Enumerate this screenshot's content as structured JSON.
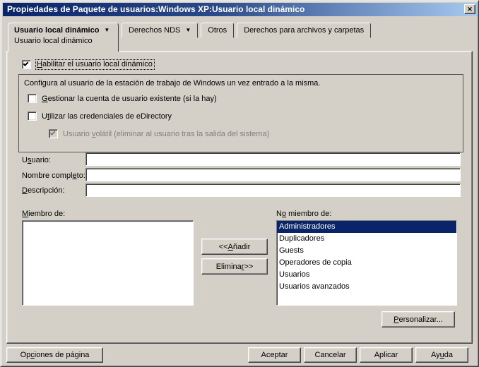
{
  "window": {
    "title": "Propiedades de Paquete de usuarios:Windows XP:Usuario local dinámico"
  },
  "icons": {
    "close": "✕",
    "dropdown": "▼"
  },
  "colors": {
    "dialog_bg": "#D4D0C8",
    "titlebar_gradient_start": "#0A246A",
    "titlebar_gradient_end": "#A6CAF0",
    "selection_bg": "#0A246A",
    "selection_text": "#FFFFFF",
    "disabled_text": "#808080"
  },
  "tabs": {
    "active": {
      "label": "Usuario local dinámico",
      "sub_label": "Usuario local dinámico",
      "has_dropdown": true
    },
    "items": [
      {
        "label": "Derechos NDS",
        "has_dropdown": true
      },
      {
        "label": "Otros",
        "has_dropdown": false
      },
      {
        "label": "Derechos para archivos y carpetas",
        "has_dropdown": false
      }
    ]
  },
  "checkboxes": {
    "enable": {
      "pre": "",
      "key": "H",
      "post": "abilitar el usuario local dinámico",
      "checked": true,
      "focused": true
    },
    "manage": {
      "pre": "",
      "key": "G",
      "post": "estionar la cuenta de usuario existente (si la hay)",
      "checked": false
    },
    "credentials": {
      "pre": "U",
      "key": "t",
      "post": "ilizar las credenciales de eDirectory",
      "checked": false
    },
    "volatile": {
      "pre": "Usuario ",
      "key": "v",
      "post": "olátil (eliminar al usuario tras la salida del sistema)",
      "checked": true,
      "disabled": true
    }
  },
  "group": {
    "intro": "Configura al usuario de la estación de trabajo de Windows un vez entrado a la misma."
  },
  "fields": {
    "user": {
      "pre": "U",
      "key": "s",
      "post": "uario:",
      "value": ""
    },
    "full_name": {
      "pre": "Nombre compl",
      "key": "e",
      "post": "to:",
      "value": ""
    },
    "description": {
      "pre": "",
      "key": "D",
      "post": "escripción:",
      "value": ""
    }
  },
  "lists": {
    "member": {
      "pre": "",
      "key": "M",
      "post": "iembro de:",
      "items": []
    },
    "not_member": {
      "pre": "N",
      "key": "o",
      "post": " miembro de:",
      "selected": "Administradores",
      "items": [
        "Administradores",
        "Duplicadores",
        "Guests",
        "Operadores de copia",
        "Usuarios",
        "Usuarios avanzados"
      ]
    }
  },
  "buttons": {
    "add": {
      "pre": "<< ",
      "key": "A",
      "post": "ñadir"
    },
    "remove": {
      "pre": "Elimina",
      "key": "r",
      "post": " >>"
    },
    "customize": {
      "pre": "",
      "key": "P",
      "post": "ersonalizar..."
    },
    "page_options": {
      "pre": "Op",
      "key": "c",
      "post": "iones de página"
    },
    "ok": {
      "pre": "Aceptar",
      "key": "",
      "post": ""
    },
    "cancel": {
      "pre": "Cancelar",
      "key": "",
      "post": ""
    },
    "apply": {
      "pre": "Aplicar",
      "key": "",
      "post": ""
    },
    "help": {
      "pre": "Ay",
      "key": "u",
      "post": "da"
    }
  }
}
